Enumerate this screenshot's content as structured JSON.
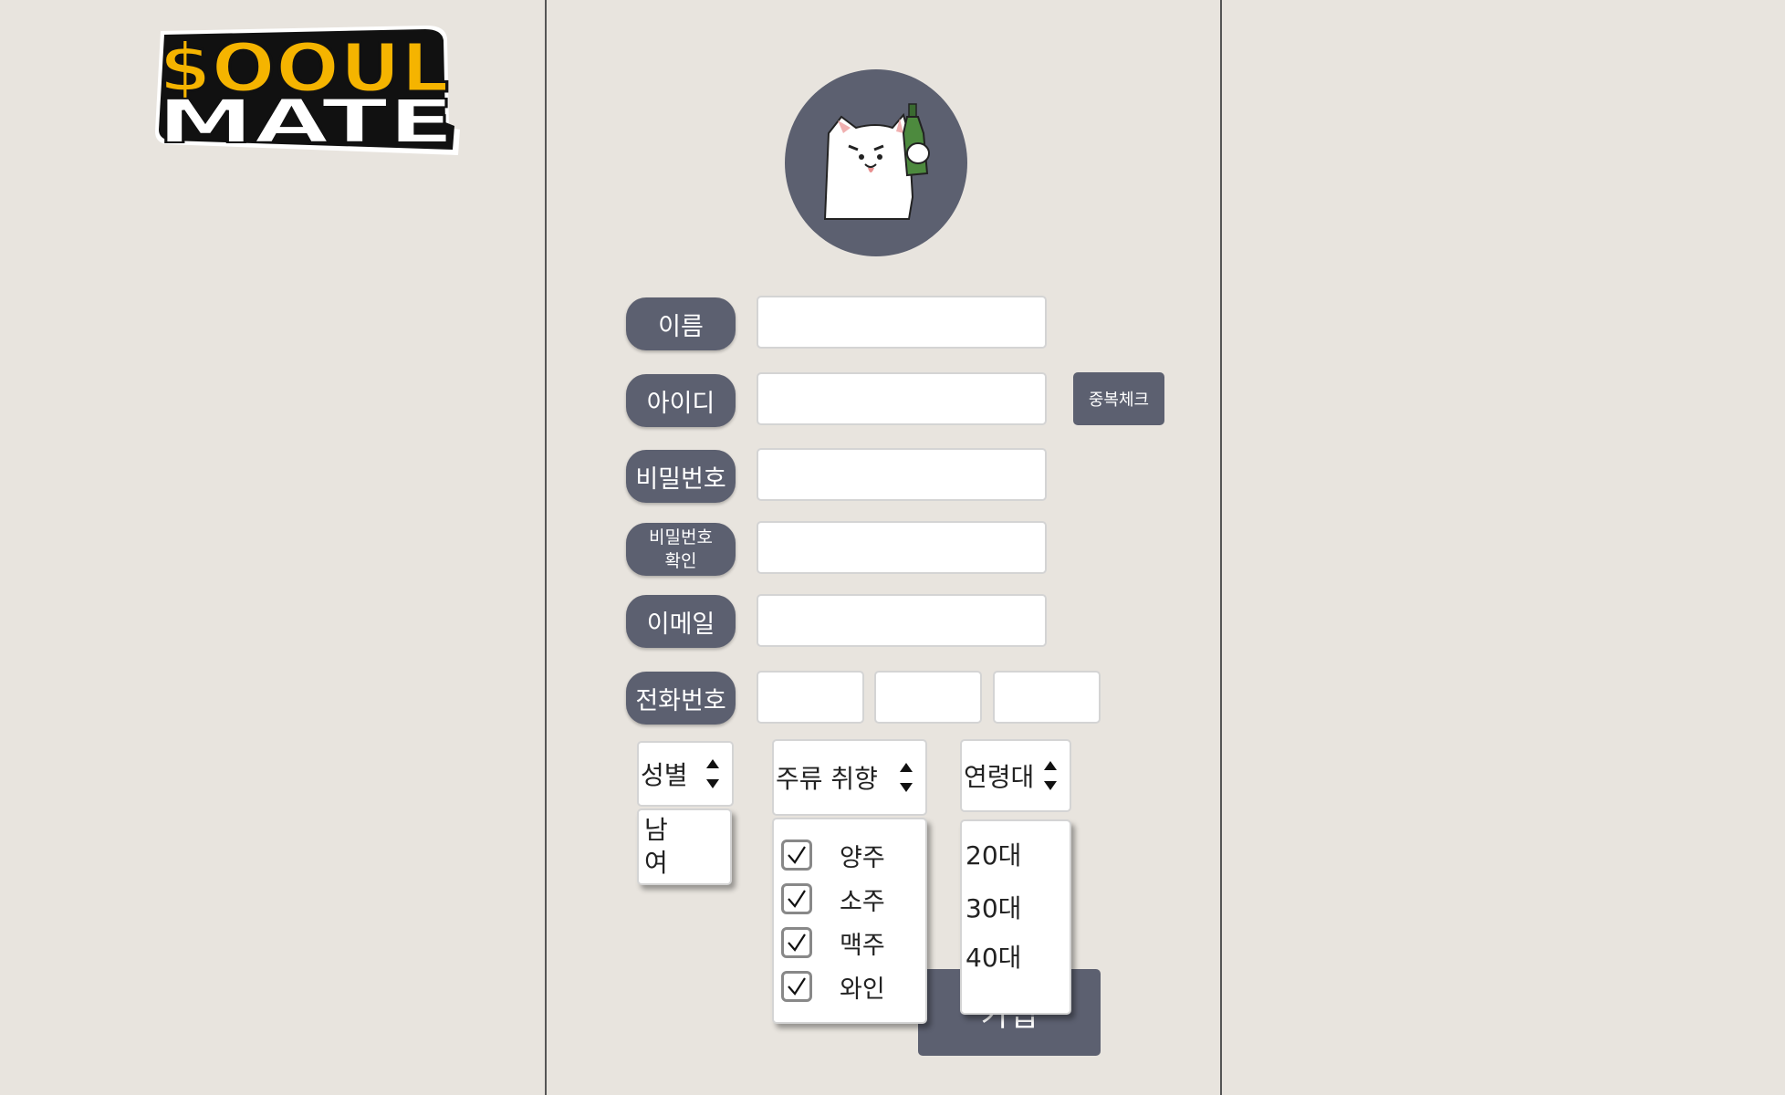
{
  "logo": {
    "line1": "$OOUL",
    "line2": "MATE"
  },
  "form": {
    "name_label": "이름",
    "id_label": "아이디",
    "password_label": "비밀번호",
    "password_confirm_label_line1": "비밀번호",
    "password_confirm_label_line2": "확인",
    "email_label": "이메일",
    "phone_label": "전화번호",
    "dup_check_label": "중복체크",
    "name_value": "",
    "id_value": "",
    "password_value": "",
    "password_confirm_value": "",
    "email_value": "",
    "phone1_value": "",
    "phone2_value": "",
    "phone3_value": ""
  },
  "gender": {
    "label": "성별",
    "options": [
      "남",
      "여"
    ]
  },
  "drink_pref": {
    "label": "주류 취향",
    "options": [
      {
        "label": "양주",
        "checked": true
      },
      {
        "label": "소주",
        "checked": true
      },
      {
        "label": "맥주",
        "checked": true
      },
      {
        "label": "와인",
        "checked": true
      }
    ]
  },
  "age_group": {
    "label": "연령대",
    "options": [
      "20대",
      "30대",
      "40대"
    ]
  },
  "submit_label": "가입",
  "colors": {
    "accent": "#5c6070",
    "background": "#e8e4de",
    "logo_yellow": "#f5b400"
  }
}
